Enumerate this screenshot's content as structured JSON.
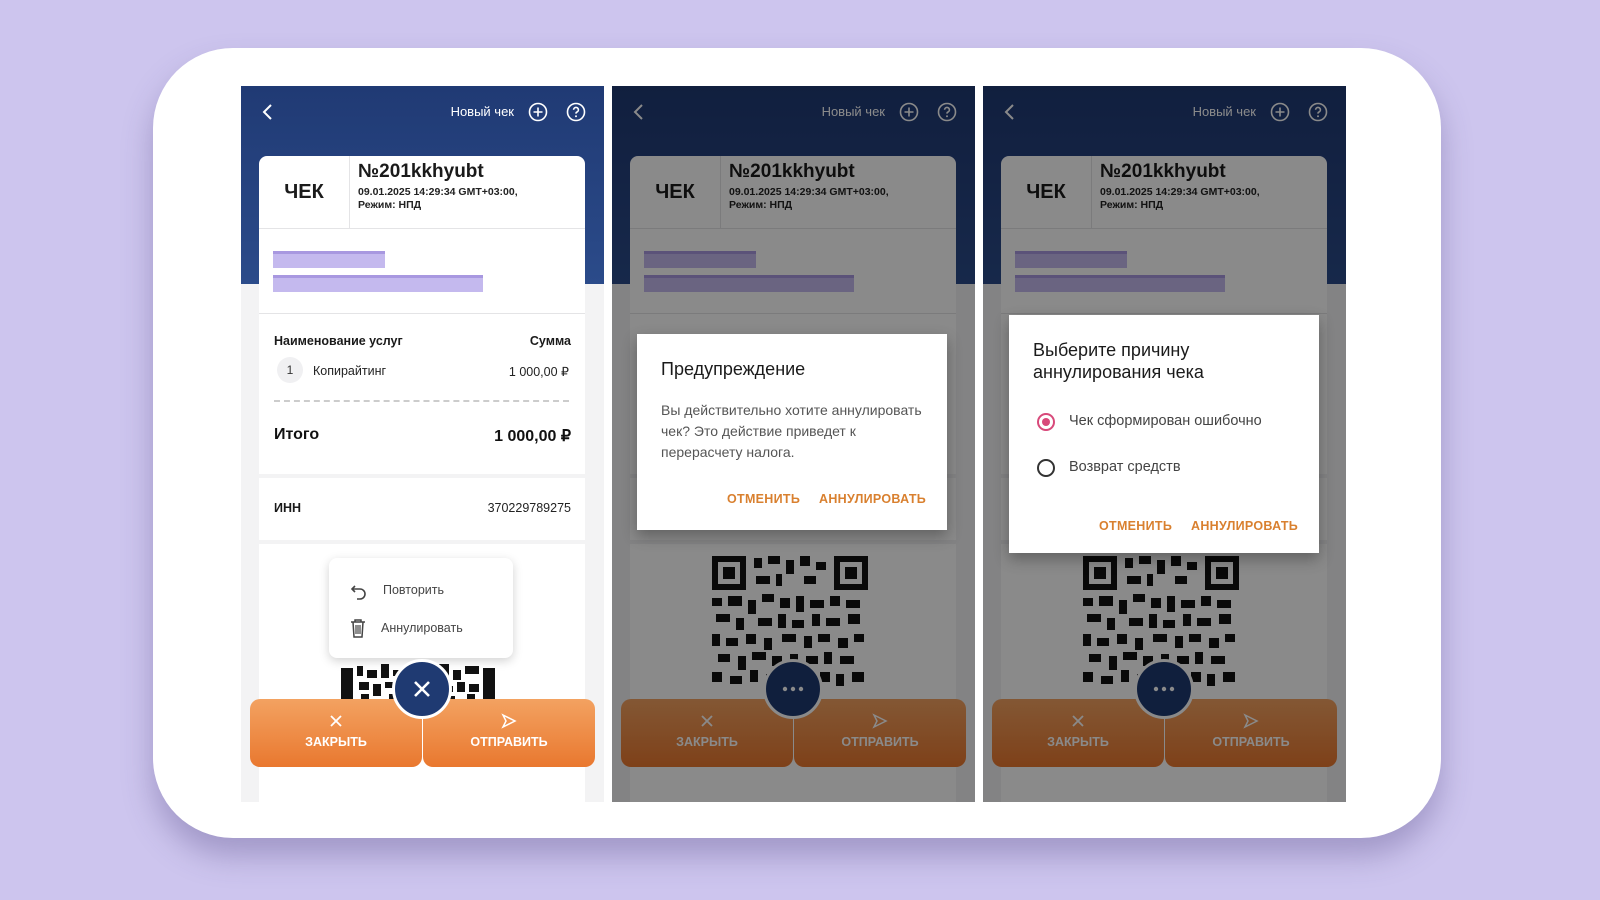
{
  "header": {
    "new_check": "Новый чек"
  },
  "receipt": {
    "label": "ЧЕК",
    "number": "№201kkhyubt",
    "datetime": "09.01.2025 14:29:34 GMT+03:00,",
    "mode": "Режим: НПД"
  },
  "items": {
    "col_name": "Наименование услуг",
    "col_sum": "Сумма",
    "rows": [
      {
        "index": "1",
        "name": "Копирайтинг",
        "amount": "1 000,00 ₽"
      }
    ],
    "total_label": "Итого",
    "total_value": "1 000,00 ₽"
  },
  "inn": {
    "label": "ИНН",
    "value": "370229789275"
  },
  "menu": {
    "repeat": "Повторить",
    "annul": "Аннулировать"
  },
  "buttons": {
    "close": "ЗАКРЫТЬ",
    "send": "ОТПРАВИТЬ"
  },
  "warning_dialog": {
    "title": "Предупреждение",
    "text": "Вы действительно хотите аннулировать чек? Это действие приведет к перерасчету налога.",
    "cancel": "ОТМЕНИТЬ",
    "confirm": "АННУЛИРОВАТЬ"
  },
  "reason_dialog": {
    "title_line1": "Выберите причину",
    "title_line2": "аннулирования чека",
    "options": [
      {
        "label": "Чек сформирован ошибочно",
        "selected": true
      },
      {
        "label": "Возврат средств",
        "selected": false
      }
    ],
    "cancel": "ОТМЕНИТЬ",
    "confirm": "АННУЛИРОВАТЬ"
  },
  "colors": {
    "header_blue": "#203a74",
    "accent_orange": "#e9782f",
    "dialog_button": "#d9802f",
    "radio_selected": "#d8497a"
  }
}
